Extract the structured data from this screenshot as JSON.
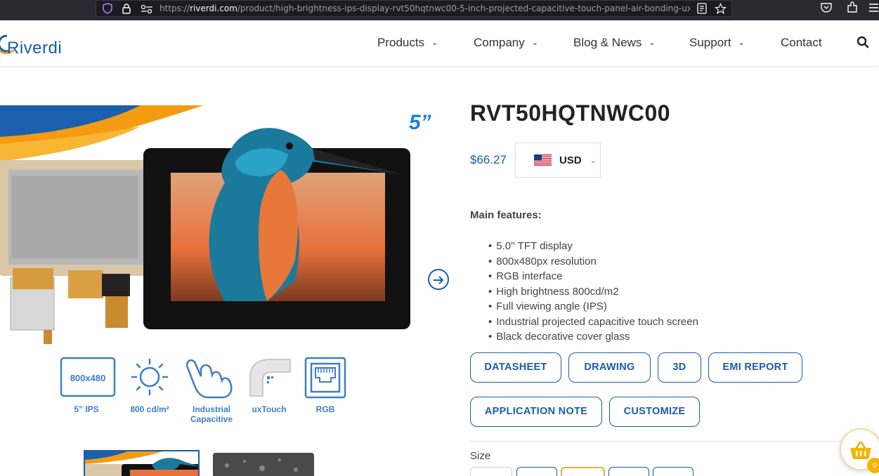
{
  "browser": {
    "url_prefix": "https://",
    "url_host": "riverdi.com",
    "url_path": "/product/high-brightness-ips-display-rvt50hqtnwc00-5-inch-projected-capacitive-touch-panel-air-bonding-uxt"
  },
  "header": {
    "logo_text": "Riverdi",
    "nav": [
      {
        "label": "Products",
        "has_dropdown": true
      },
      {
        "label": "Company",
        "has_dropdown": true
      },
      {
        "label": "Blog & News",
        "has_dropdown": true
      },
      {
        "label": "Support",
        "has_dropdown": true
      },
      {
        "label": "Contact",
        "has_dropdown": false
      }
    ]
  },
  "gallery": {
    "size_badge": "5”",
    "spec_icons": [
      {
        "icon": "resolution-icon",
        "inner_text": "800x480",
        "label": "5” IPS"
      },
      {
        "icon": "brightness-sun-icon",
        "label": "800 cd/m²"
      },
      {
        "icon": "touch-hand-icon",
        "label": "Industrial Capacitive"
      },
      {
        "icon": "uxtouch-corner-icon",
        "label": "uxTouch"
      },
      {
        "icon": "rgb-connector-icon",
        "label": "RGB"
      }
    ]
  },
  "product": {
    "title": "RVT50HQTNWC00",
    "price": "$66.27",
    "currency": "USD",
    "features_title": "Main features:",
    "features": [
      "5.0'' TFT display",
      "800x480px resolution",
      "RGB interface",
      "High brightness 800cd/m2",
      "Full viewing angle (IPS)",
      "Industrial projected capacitive touch screen",
      "Black decorative cover glass"
    ],
    "buttons": [
      "DATASHEET",
      "DRAWING",
      "3D",
      "EMI REPORT",
      "APPLICATION NOTE",
      "CUSTOMIZE"
    ],
    "size_label": "Size"
  },
  "cart": {
    "count": "0"
  },
  "colors": {
    "brand_blue": "#1a5ca8",
    "accent_orange": "#f5b400"
  }
}
